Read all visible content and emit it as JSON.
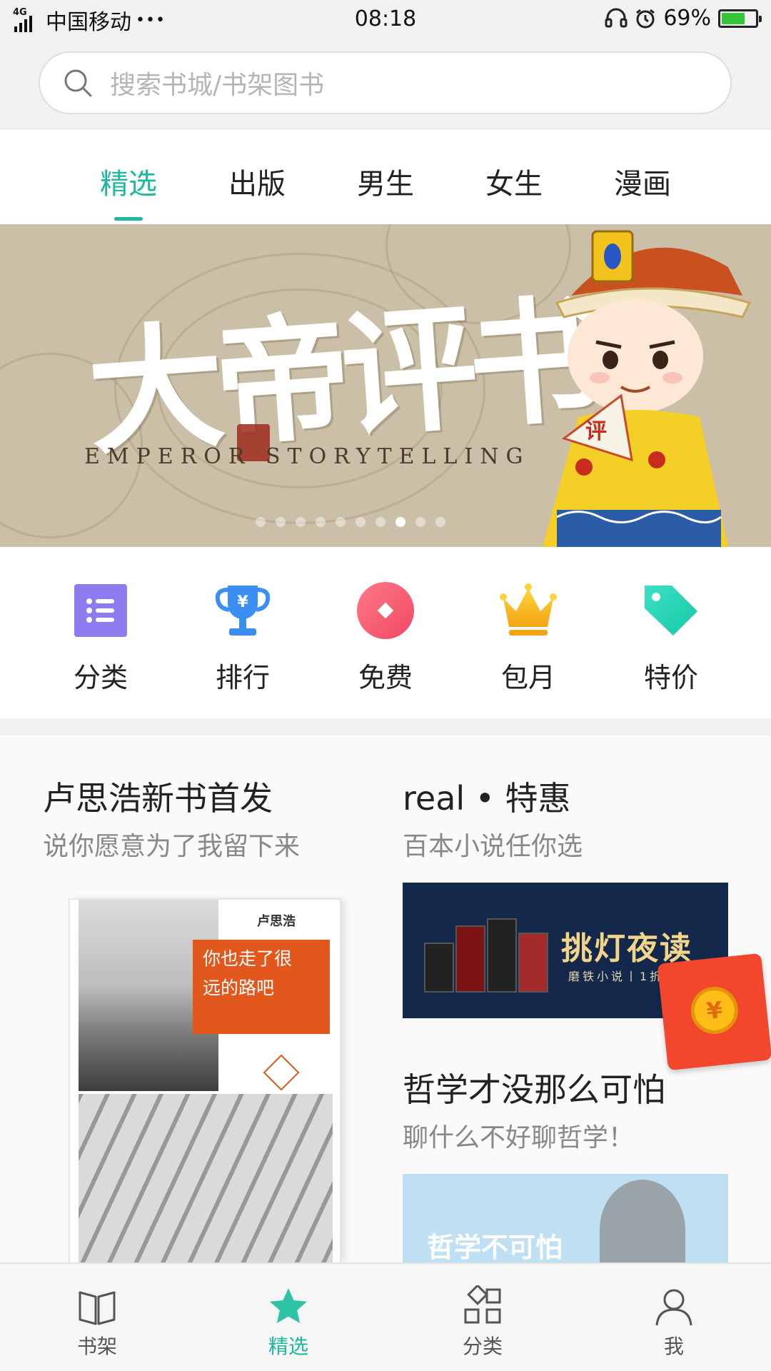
{
  "status_bar": {
    "network": "4G",
    "carrier": "中国移动",
    "more": "•••",
    "time": "08:18",
    "battery": "69%",
    "battery_level": 0.69,
    "battery_color": "#37c43a"
  },
  "search": {
    "placeholder": "搜索书城/书架图书",
    "icon": "search-icon"
  },
  "tabs": {
    "items": [
      {
        "label": "精选",
        "active": true
      },
      {
        "label": "出版",
        "active": false
      },
      {
        "label": "男生",
        "active": false
      },
      {
        "label": "女生",
        "active": false
      },
      {
        "label": "漫画",
        "active": false
      }
    ],
    "accent_color": "#1eb99c"
  },
  "banner": {
    "title": "大帝评书",
    "subtitle": "EMPEROR STORYTELLING",
    "slide_count": 10,
    "active_slide": 7
  },
  "quick_links": [
    {
      "label": "分类",
      "icon": "list-icon",
      "color": "#8f7bf0"
    },
    {
      "label": "排行",
      "icon": "trophy-icon",
      "color": "#3b8ef2"
    },
    {
      "label": "免费",
      "icon": "free-icon",
      "color": "#f25a73"
    },
    {
      "label": "包月",
      "icon": "crown-icon",
      "color": "#f6b21b"
    },
    {
      "label": "特价",
      "icon": "tag-icon",
      "color": "#26d3b3"
    }
  ],
  "features": {
    "left": {
      "title": "卢思浩新书首发",
      "subtitle": "说你愿意为了我留下来",
      "book": {
        "title": "你也走了很远的路吧",
        "author": "卢思浩"
      }
    },
    "right_top": {
      "title": "real • 特惠",
      "subtitle": "百本小说任你选",
      "promo_text": "挑灯夜读",
      "promo_sub": "磨铁小说丨1折"
    },
    "right_bottom": {
      "title": "哲学才没那么可怕",
      "subtitle": "聊什么不好聊哲学！",
      "promo_text": "哲学不可怕"
    },
    "red_packet_symbol": "¥"
  },
  "bottom_nav": [
    {
      "label": "书架",
      "icon": "book-icon",
      "active": false
    },
    {
      "label": "精选",
      "icon": "star-icon",
      "active": true
    },
    {
      "label": "分类",
      "icon": "grid-icon",
      "active": false
    },
    {
      "label": "我",
      "icon": "user-icon",
      "active": false
    }
  ]
}
